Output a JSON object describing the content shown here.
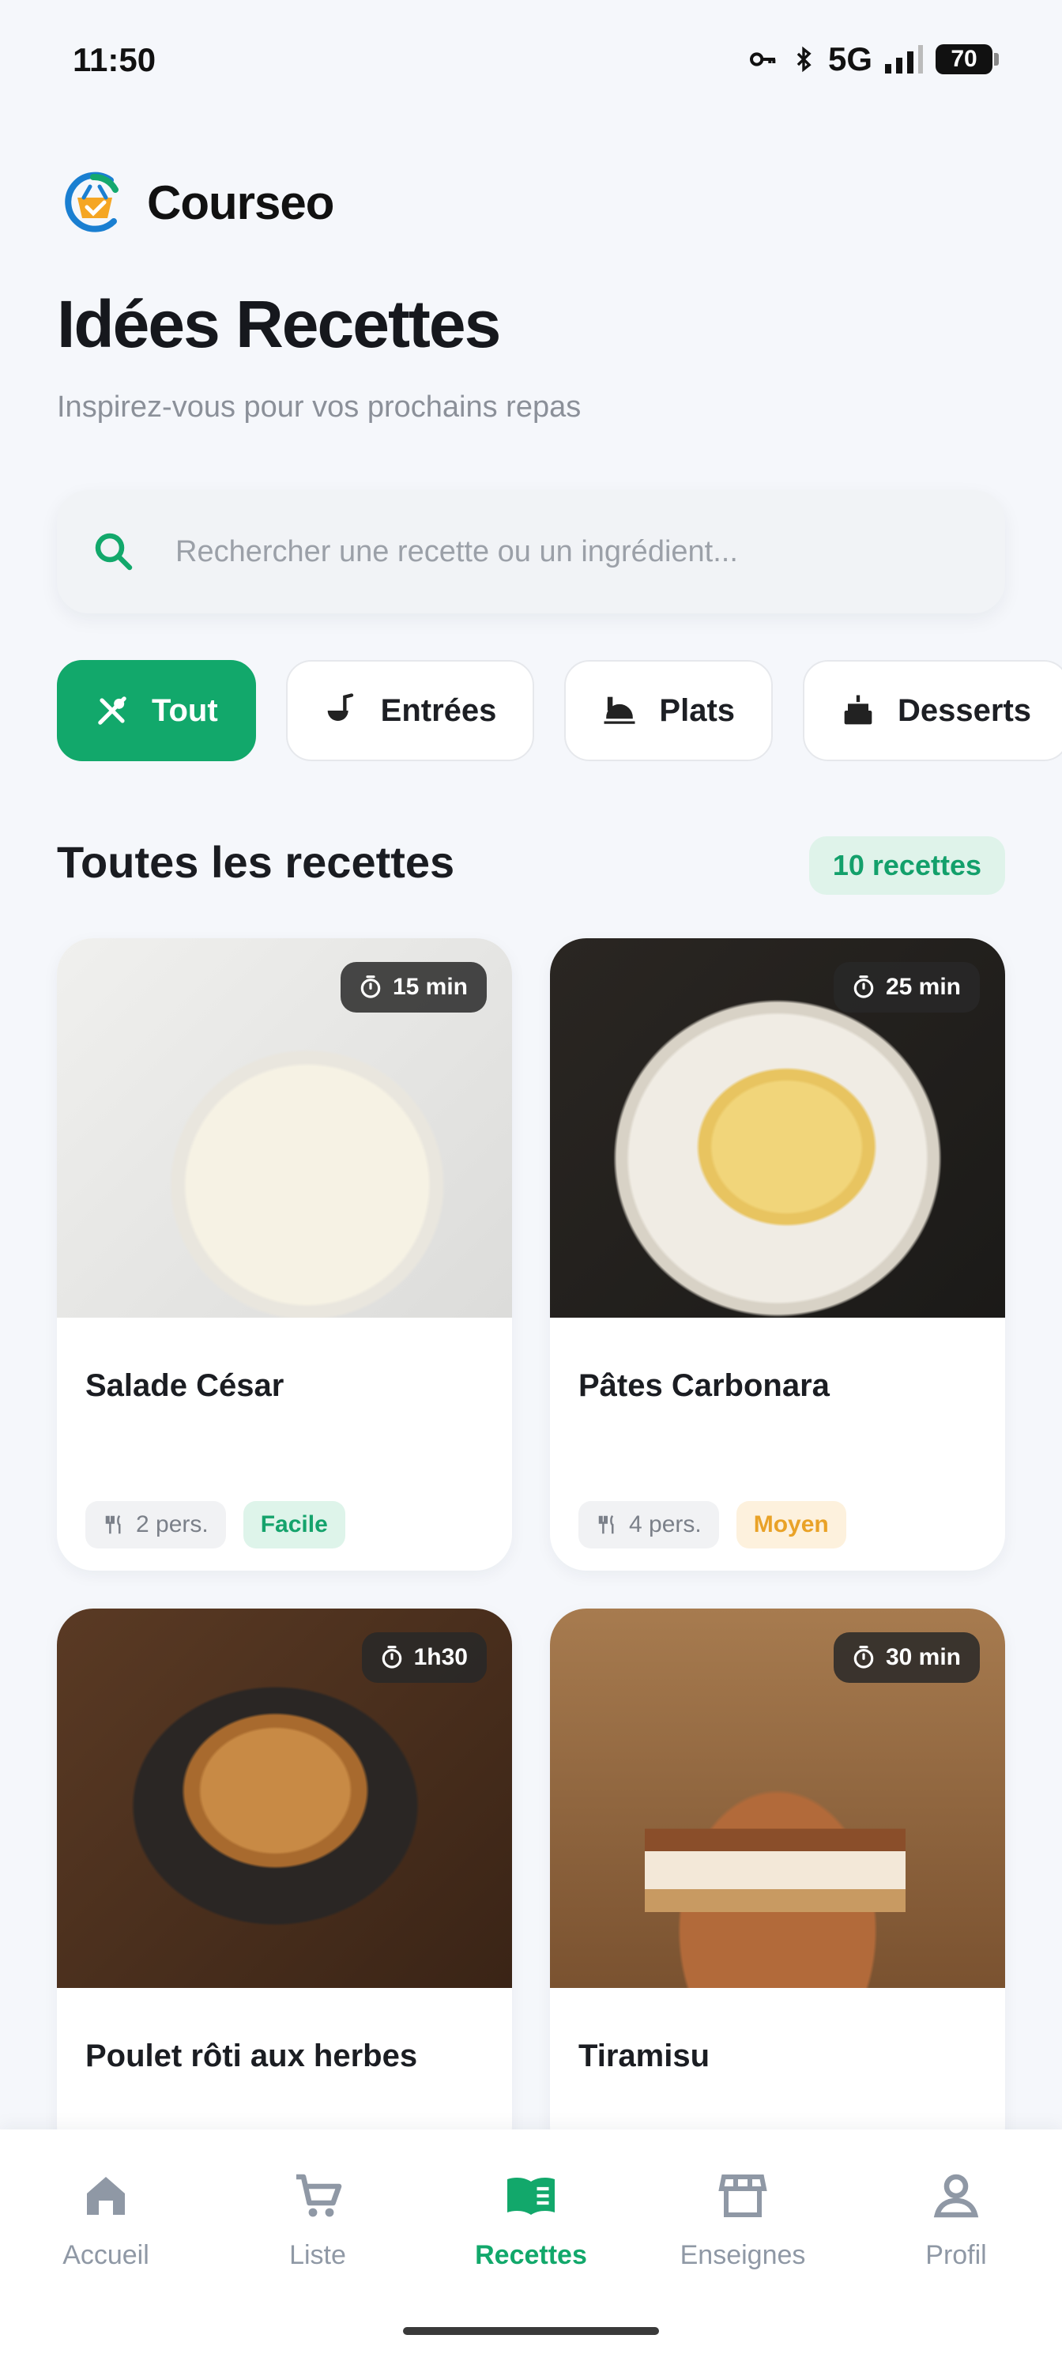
{
  "status_bar": {
    "time": "11:50",
    "network": "5G",
    "battery": "70"
  },
  "brand": {
    "name": "Courseo"
  },
  "header": {
    "title": "Idées Recettes",
    "subtitle": "Inspirez-vous pour vos prochains repas"
  },
  "search": {
    "placeholder": "Rechercher une recette ou un ingrédient...",
    "value": ""
  },
  "categories": [
    {
      "label": "Tout",
      "icon": "utensils-icon",
      "active": true
    },
    {
      "label": "Entrées",
      "icon": "ladle-icon",
      "active": false
    },
    {
      "label": "Plats",
      "icon": "dish-icon",
      "active": false
    },
    {
      "label": "Desserts",
      "icon": "cake-icon",
      "active": false
    }
  ],
  "section": {
    "title": "Toutes les recettes",
    "count_label": "10 recettes"
  },
  "recipes": [
    {
      "name": "Salade César",
      "time": "15 min",
      "servings": "2 pers.",
      "difficulty": "Facile"
    },
    {
      "name": "Pâtes Carbonara",
      "time": "25 min",
      "servings": "4 pers.",
      "difficulty": "Moyen"
    },
    {
      "name": "Poulet rôti aux herbes",
      "time": "1h30"
    },
    {
      "name": "Tiramisu",
      "time": "30 min"
    }
  ],
  "nav": [
    {
      "label": "Accueil",
      "icon": "home-icon",
      "active": false
    },
    {
      "label": "Liste",
      "icon": "cart-icon",
      "active": false
    },
    {
      "label": "Recettes",
      "icon": "book-icon",
      "active": true
    },
    {
      "label": "Enseignes",
      "icon": "store-icon",
      "active": false
    },
    {
      "label": "Profil",
      "icon": "user-icon",
      "active": false
    }
  ],
  "colors": {
    "accent": "#12a86b",
    "easy": "#15a36c",
    "medium": "#e9a227",
    "background": "#f5f7fb"
  }
}
